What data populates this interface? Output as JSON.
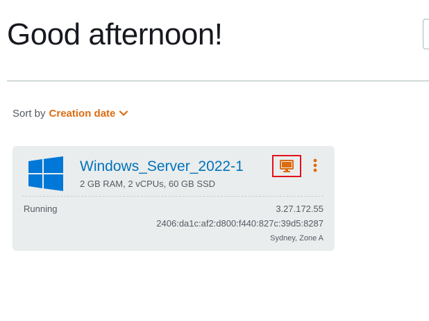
{
  "header": {
    "greeting": "Good afternoon!"
  },
  "sort": {
    "label": "Sort by",
    "value": "Creation date"
  },
  "instances": [
    {
      "name": "Windows_Server_2022-1",
      "specs": "2 GB RAM, 2 vCPUs, 60 GB SSD",
      "status": "Running",
      "public_ipv4": "3.27.172.55",
      "ipv6": "2406:da1c:af2:d800:f440:827c:39d5:8287",
      "location": "Sydney, Zone A",
      "os_icon": "windows-logo-icon",
      "connect_icon": "monitor-icon",
      "menu_icon": "kebab-menu-icon"
    }
  ],
  "colors": {
    "accent_orange": "#dd6b10",
    "link_blue": "#0073bb",
    "windows_blue": "#0078d7",
    "highlight_red": "#e0121c",
    "card_bg": "#eaeded",
    "text_primary": "#16191f",
    "text_secondary": "#545b64"
  }
}
